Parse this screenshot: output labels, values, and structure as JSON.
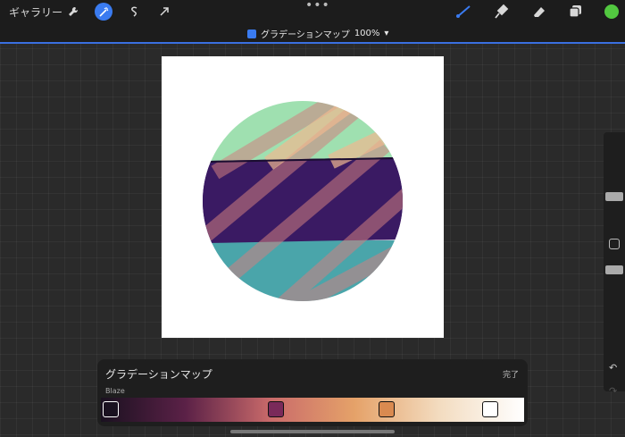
{
  "toolbar": {
    "gallery_label": "ギャラリー",
    "left_tools": [
      "wrench-icon",
      "magic-wand-icon",
      "selection-icon",
      "transform-arrow-icon"
    ],
    "active_tool": "magic-wand-icon",
    "more": "•••",
    "right_tools": [
      "brush-icon",
      "smudge-icon",
      "eraser-icon",
      "layers-icon"
    ],
    "active_right_tool": "brush-icon",
    "color": "#52c840",
    "accent": "#3a7bf0"
  },
  "layer": {
    "name": "グラデーションマップ",
    "opacity": "100%",
    "chevron": "▾"
  },
  "sidebar": {
    "undo": "↶",
    "redo": "↷"
  },
  "panel": {
    "title": "グラデーションマップ",
    "done": "完了",
    "preset": "Blaze",
    "gradient_colors": [
      "#1a1120",
      "#5b2147",
      "#c96a6a",
      "#e5a269",
      "#f3dcc0",
      "#ffffff"
    ],
    "stop_colors": [
      "#1a1120",
      "#7a2a5a",
      "#d98a50",
      "#ffffff"
    ]
  }
}
